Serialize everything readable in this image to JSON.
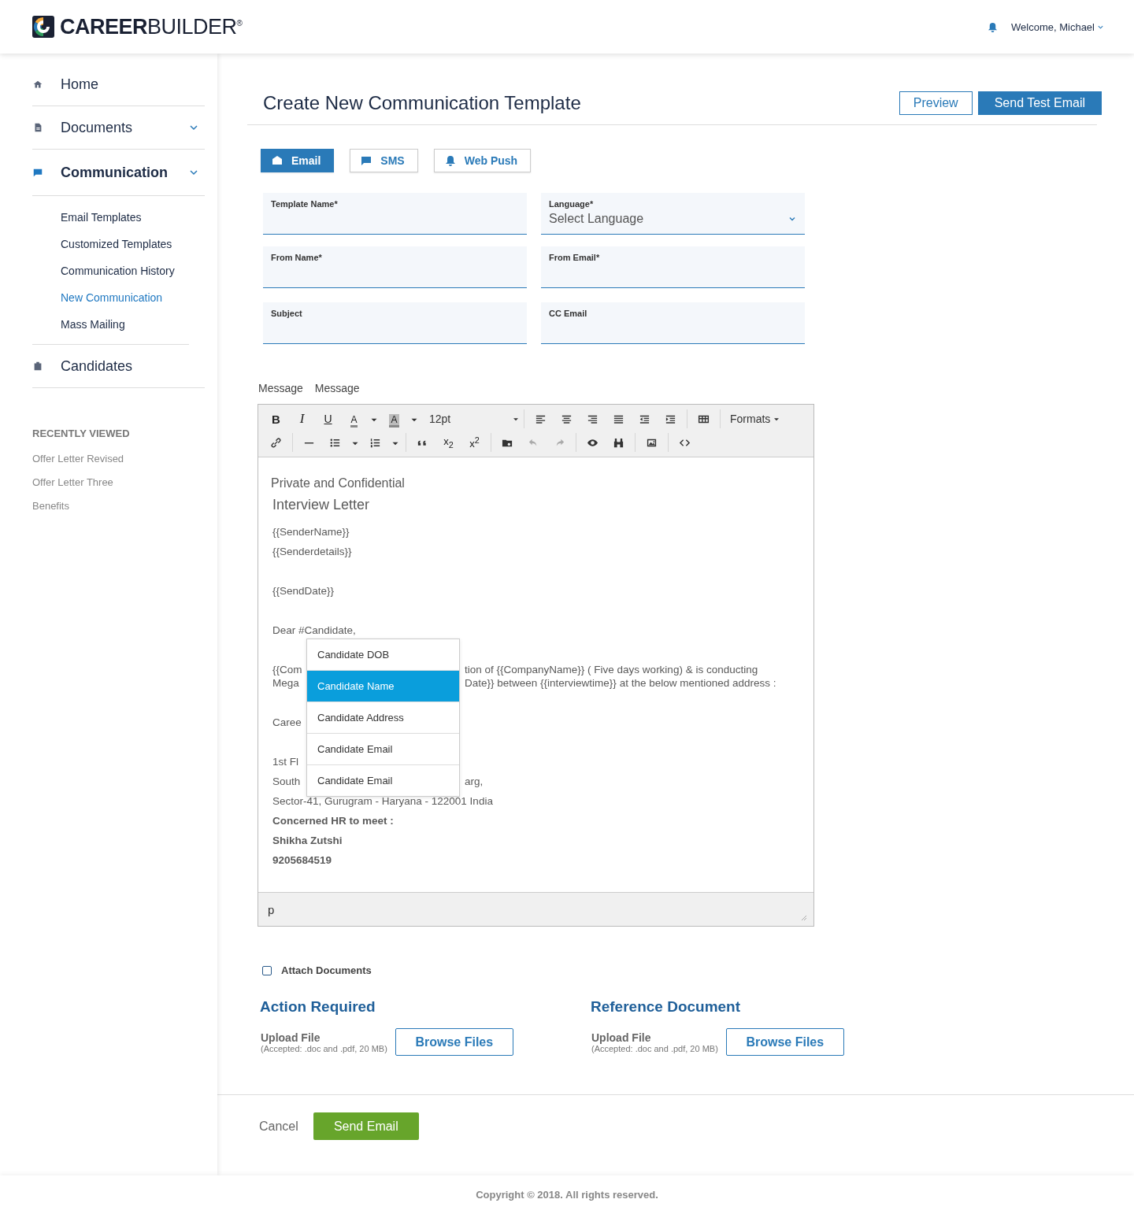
{
  "header": {
    "logo": "**CAREER**BUILDER$^{®}$",
    "welcome": "Welcome, Michael"
  },
  "sidebar": {
    "items": [
      {
        "label": "Home",
        "expandable": false,
        "selected": false
      },
      {
        "label": "Documents",
        "expandable": true,
        "selected": false
      },
      {
        "label": "Communication",
        "expandable": true,
        "selected": true,
        "children": [
          {
            "label": "Email Templates",
            "selected": false
          },
          {
            "label": "Customized Templates",
            "selected": false
          },
          {
            "label": "Communication History",
            "selected": false
          },
          {
            "label": "New Communication",
            "selected": true
          },
          {
            "label": "Mass Mailing",
            "selected": false
          }
        ]
      },
      {
        "label": "Candidates",
        "expandable": false,
        "selected": false
      }
    ],
    "recently_viewed": {
      "title": "RECENTLY VIEWED",
      "items": [
        "Offer Letter Revised",
        "Offer Letter Three",
        "Benefits"
      ]
    }
  },
  "page": {
    "title": "Create New Communication Template",
    "buttons": [
      {
        "label": "Preview",
        "kind": "outline"
      },
      {
        "label": "Send Test Email",
        "kind": "primary"
      }
    ]
  },
  "channel_tabs": [
    {
      "label": "Email",
      "selected": true
    },
    {
      "label": "SMS",
      "selected": false
    },
    {
      "label": "Web Push",
      "selected": false
    }
  ],
  "fields": [
    {
      "label": "Template Name*",
      "kind": "text"
    },
    {
      "label": "Language*",
      "kind": "select",
      "value": "Select Language"
    },
    {
      "label": "From Name*",
      "kind": "text"
    },
    {
      "label": "From Email*",
      "kind": "text"
    },
    {
      "label": "Subject",
      "kind": "text"
    },
    {
      "label": "CC Email",
      "kind": "text"
    }
  ],
  "message_labels": [
    "Message",
    "Message"
  ],
  "editor": {
    "toolbar_texts": [
      "B",
      "I",
      "U",
      "A",
      "A",
      "12pt",
      "Formats",
      "x$_{2}$",
      "x$^{2}$"
    ],
    "undo": {
      "disabled": true
    },
    "redo": {
      "disabled": true
    },
    "content": [
      {
        "kind": "subtitle",
        "text": "Private and Confidential"
      },
      {
        "kind": "heading",
        "text": "Interview Letter"
      },
      {
        "kind": "line",
        "text": "{{SenderName}}"
      },
      {
        "kind": "line",
        "text": "{{Senderdetails}}"
      },
      {
        "kind": "blank"
      },
      {
        "kind": "line",
        "text": "{{SendDate}}"
      },
      {
        "kind": "blank"
      },
      {
        "kind": "line",
        "text": "Dear #Candidate,"
      },
      {
        "kind": "blank"
      },
      {
        "kind": "paragraph",
        "lines": [
          {
            "left": "{{Com",
            "right": "tion of  {{CompanyName}} ( Five days working) & is conducting"
          },
          {
            "left": "Mega",
            "right": "Date}} between {{interviewtime}} at the below mentioned address :"
          }
        ]
      },
      {
        "kind": "blank"
      },
      {
        "kind": "split",
        "left": "Caree"
      },
      {
        "kind": "blank"
      },
      {
        "kind": "split",
        "left": "1st Fl"
      },
      {
        "kind": "split",
        "left": "South",
        "right": "arg,"
      },
      {
        "kind": "line",
        "text": "Sector-41, Gurugram - Haryana - 122001 India"
      },
      {
        "kind": "strong",
        "text": "Concerned HR to meet :"
      },
      {
        "kind": "strong",
        "text": "Shikha Zutshi"
      },
      {
        "kind": "strong",
        "text": "9205684519"
      }
    ],
    "suggestions": [
      {
        "label": "Candidate DOB",
        "selected": false
      },
      {
        "label": "Candidate Name",
        "selected": true
      },
      {
        "label": "Candidate Address",
        "selected": false
      },
      {
        "label": "Candidate Email",
        "selected": false
      },
      {
        "label": "Candidate Email",
        "selected": false
      }
    ],
    "status_path": "p"
  },
  "attach": {
    "label": "Attach Documents",
    "checked": false
  },
  "uploads": [
    {
      "title": "Action Required",
      "label": "Upload File",
      "hint": "(Accepted: .doc and .pdf, 20 MB)",
      "button": "Browse Files"
    },
    {
      "title": "Reference Document",
      "label": "Upload File",
      "hint": "(Accepted: .doc and .pdf, 20 MB)",
      "button": "Browse Files"
    }
  ],
  "actions": {
    "cancel": "Cancel",
    "submit": "Send Email"
  },
  "footer": "Copyright © 2018. All rights reserved."
}
